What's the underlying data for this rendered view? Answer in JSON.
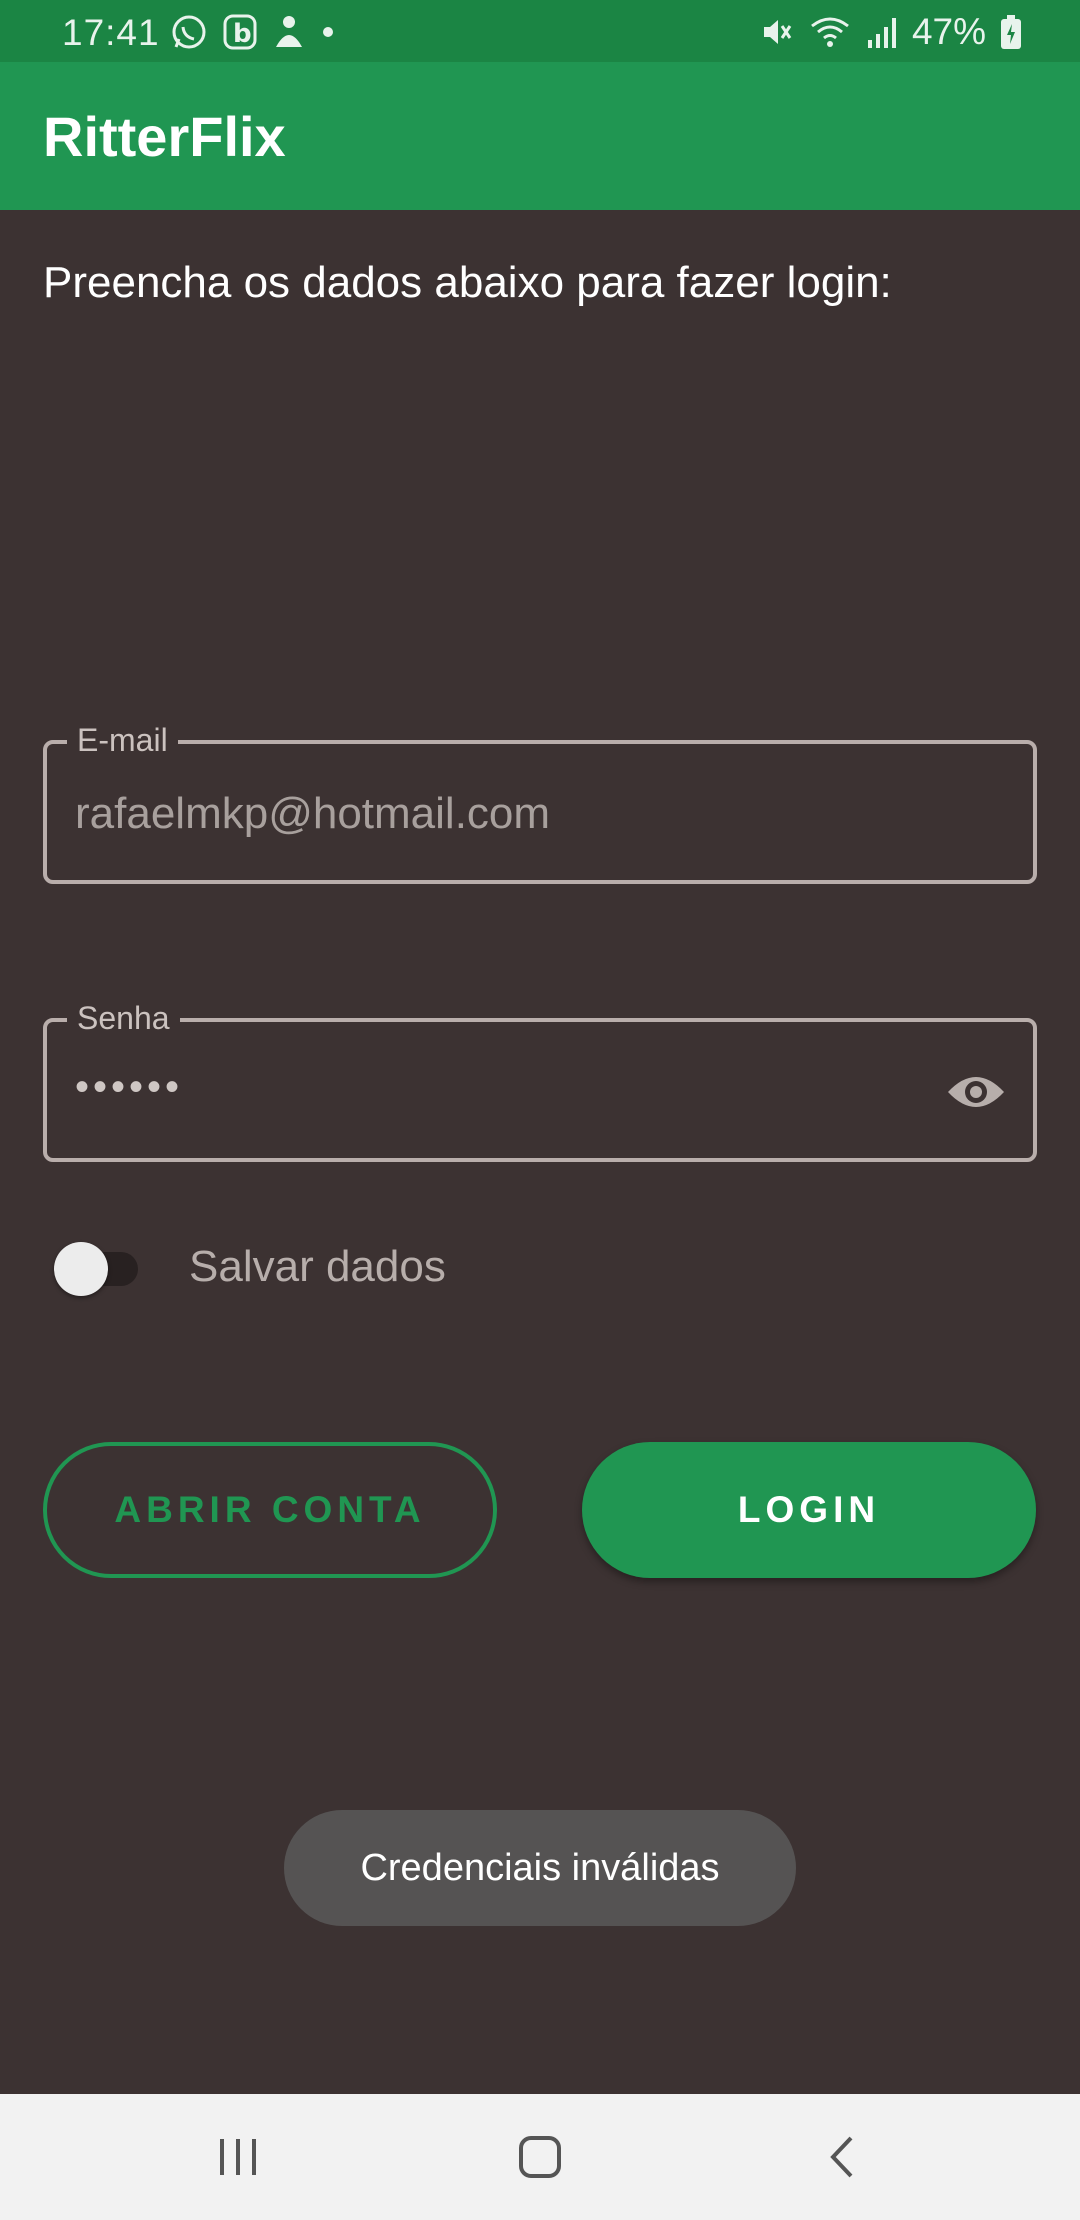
{
  "status_bar": {
    "time": "17:41",
    "battery": "47%",
    "icons_left": [
      "whatsapp-icon",
      "b-app-icon",
      "profile-icon",
      "dot-icon"
    ],
    "icons_right": [
      "mute-icon",
      "wifi-icon",
      "signal-icon",
      "battery-icon"
    ]
  },
  "app_bar": {
    "title": "RitterFlix"
  },
  "main": {
    "instruction": "Preencha os dados abaixo para fazer login:",
    "email": {
      "label": "E-mail",
      "value": "rafaelmkp@hotmail.com"
    },
    "password": {
      "label": "Senha",
      "value": "••••••",
      "toggle_icon": "eye-icon"
    },
    "save_data": {
      "label": "Salvar dados",
      "checked": false
    },
    "buttons": {
      "open_account": "ABRIR CONTA",
      "login": "LOGIN"
    }
  },
  "toast": {
    "message": "Credenciais inválidas"
  },
  "nav_bar": {
    "items": [
      "recents-icon",
      "home-icon",
      "back-icon"
    ]
  },
  "colors": {
    "status_bar": "#1b8544",
    "primary": "#209652",
    "background": "#3c3232",
    "toast": "#555353",
    "nav_bar": "#f2f2f2"
  }
}
